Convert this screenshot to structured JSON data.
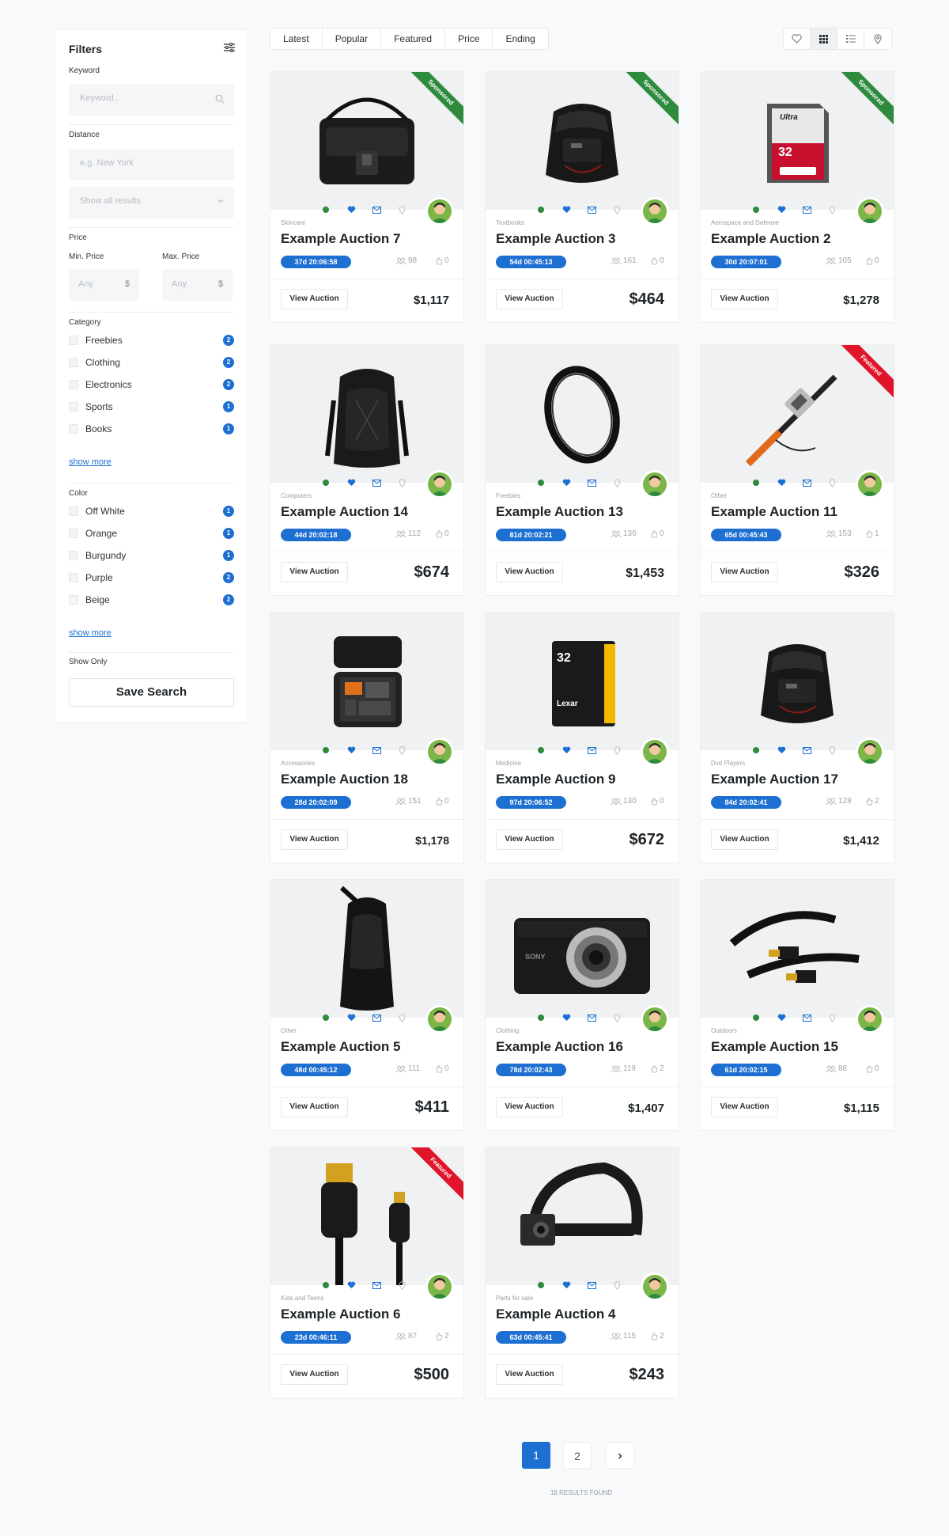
{
  "sidebar": {
    "title": "Filters",
    "keyword_label": "Keyword",
    "keyword_placeholder": "Keyword..",
    "distance_label": "Distance",
    "distance_placeholder": "e.g. New York",
    "distance_select": "Show all results",
    "price_label": "Price",
    "min_label": "Min. Price",
    "max_label": "Max. Price",
    "min_placeholder": "Any",
    "max_placeholder": "Any",
    "currency": "$",
    "category_label": "Category",
    "categories": [
      {
        "label": "Freebies",
        "count": "2"
      },
      {
        "label": "Clothing",
        "count": "2"
      },
      {
        "label": "Electronics",
        "count": "2"
      },
      {
        "label": "Sports",
        "count": "1"
      },
      {
        "label": "Books",
        "count": "1"
      }
    ],
    "show_more_1": "show more",
    "color_label": "Color",
    "colors": [
      {
        "label": "Off White",
        "count": "1"
      },
      {
        "label": "Orange",
        "count": "1"
      },
      {
        "label": "Burgundy",
        "count": "1"
      },
      {
        "label": "Purple",
        "count": "2"
      },
      {
        "label": "Beige",
        "count": "2"
      }
    ],
    "show_more_2": "show more",
    "show_only_label": "Show Only",
    "save_button": "Save Search"
  },
  "sort_tabs": [
    "Latest",
    "Popular",
    "Featured",
    "Price",
    "Ending"
  ],
  "view_icons": [
    "heart-icon",
    "grid-icon",
    "list-icon",
    "map-pin-icon"
  ],
  "accent_color": "#1d6fd1",
  "ribbon_colors": {
    "Sponsored": "#2e8b3e",
    "Featured": "#e0152a"
  },
  "view_button": "View Auction",
  "cards": [
    {
      "category": "Skincare",
      "title": "Example Auction 7",
      "timer": "37d 20:06:58",
      "views": "98",
      "bids": "0",
      "price": "$1,117",
      "ribbon": "Sponsored",
      "image": "camera-bag"
    },
    {
      "category": "Textbooks",
      "title": "Example Auction 3",
      "timer": "54d 00:45:13",
      "views": "161",
      "bids": "0",
      "price": "$464",
      "ribbon": "Sponsored",
      "image": "holster-bag"
    },
    {
      "category": "Aerospace and Defense",
      "title": "Example Auction 2",
      "timer": "30d 20:07:01",
      "views": "105",
      "bids": "0",
      "price": "$1,278",
      "ribbon": "Sponsored",
      "image": "sd-card"
    },
    {
      "category": "Computers",
      "title": "Example Auction 14",
      "timer": "44d 20:02:18",
      "views": "112",
      "bids": "0",
      "price": "$674",
      "ribbon": "",
      "image": "backpack"
    },
    {
      "category": "Freebies",
      "title": "Example Auction 13",
      "timer": "81d 20:02:21",
      "views": "136",
      "bids": "0",
      "price": "$1,453",
      "ribbon": "",
      "image": "lens-filter"
    },
    {
      "category": "Other",
      "title": "Example Auction 11",
      "timer": "65d 00:45:43",
      "views": "153",
      "bids": "1",
      "price": "$326",
      "ribbon": "Featured",
      "image": "selfie-stick"
    },
    {
      "category": "Accessories",
      "title": "Example Auction 18",
      "timer": "28d 20:02:09",
      "views": "151",
      "bids": "0",
      "price": "$1,178",
      "ribbon": "",
      "image": "camera-case"
    },
    {
      "category": "Medicine",
      "title": "Example Auction 9",
      "timer": "97d 20:06:52",
      "views": "130",
      "bids": "0",
      "price": "$672",
      "ribbon": "",
      "image": "lexar-card"
    },
    {
      "category": "Dvd Players",
      "title": "Example Auction 17",
      "timer": "84d 20:02:41",
      "views": "128",
      "bids": "2",
      "price": "$1,412",
      "ribbon": "",
      "image": "holster-bag"
    },
    {
      "category": "Other",
      "title": "Example Auction 5",
      "timer": "48d 00:45:12",
      "views": "111",
      "bids": "0",
      "price": "$411",
      "ribbon": "",
      "image": "sling-bag"
    },
    {
      "category": "Clothing",
      "title": "Example Auction 16",
      "timer": "78d 20:02:43",
      "views": "119",
      "bids": "2",
      "price": "$1,407",
      "ribbon": "",
      "image": "compact-camera"
    },
    {
      "category": "Outdoors",
      "title": "Example Auction 15",
      "timer": "61d 20:02:15",
      "views": "88",
      "bids": "0",
      "price": "$1,115",
      "ribbon": "",
      "image": "hdmi-cable"
    },
    {
      "category": "Kids and Teens",
      "title": "Example Auction 6",
      "timer": "23d 00:46:11",
      "views": "87",
      "bids": "2",
      "price": "$500",
      "ribbon": "Featured",
      "image": "micro-hdmi-cable"
    },
    {
      "category": "Parts for sale",
      "title": "Example Auction 4",
      "timer": "63d 00:45:41",
      "views": "115",
      "bids": "2",
      "price": "$243",
      "ribbon": "",
      "image": "head-strap"
    }
  ],
  "pagination": [
    "1",
    "2"
  ],
  "results_text": "18 RESULTS FOUND"
}
